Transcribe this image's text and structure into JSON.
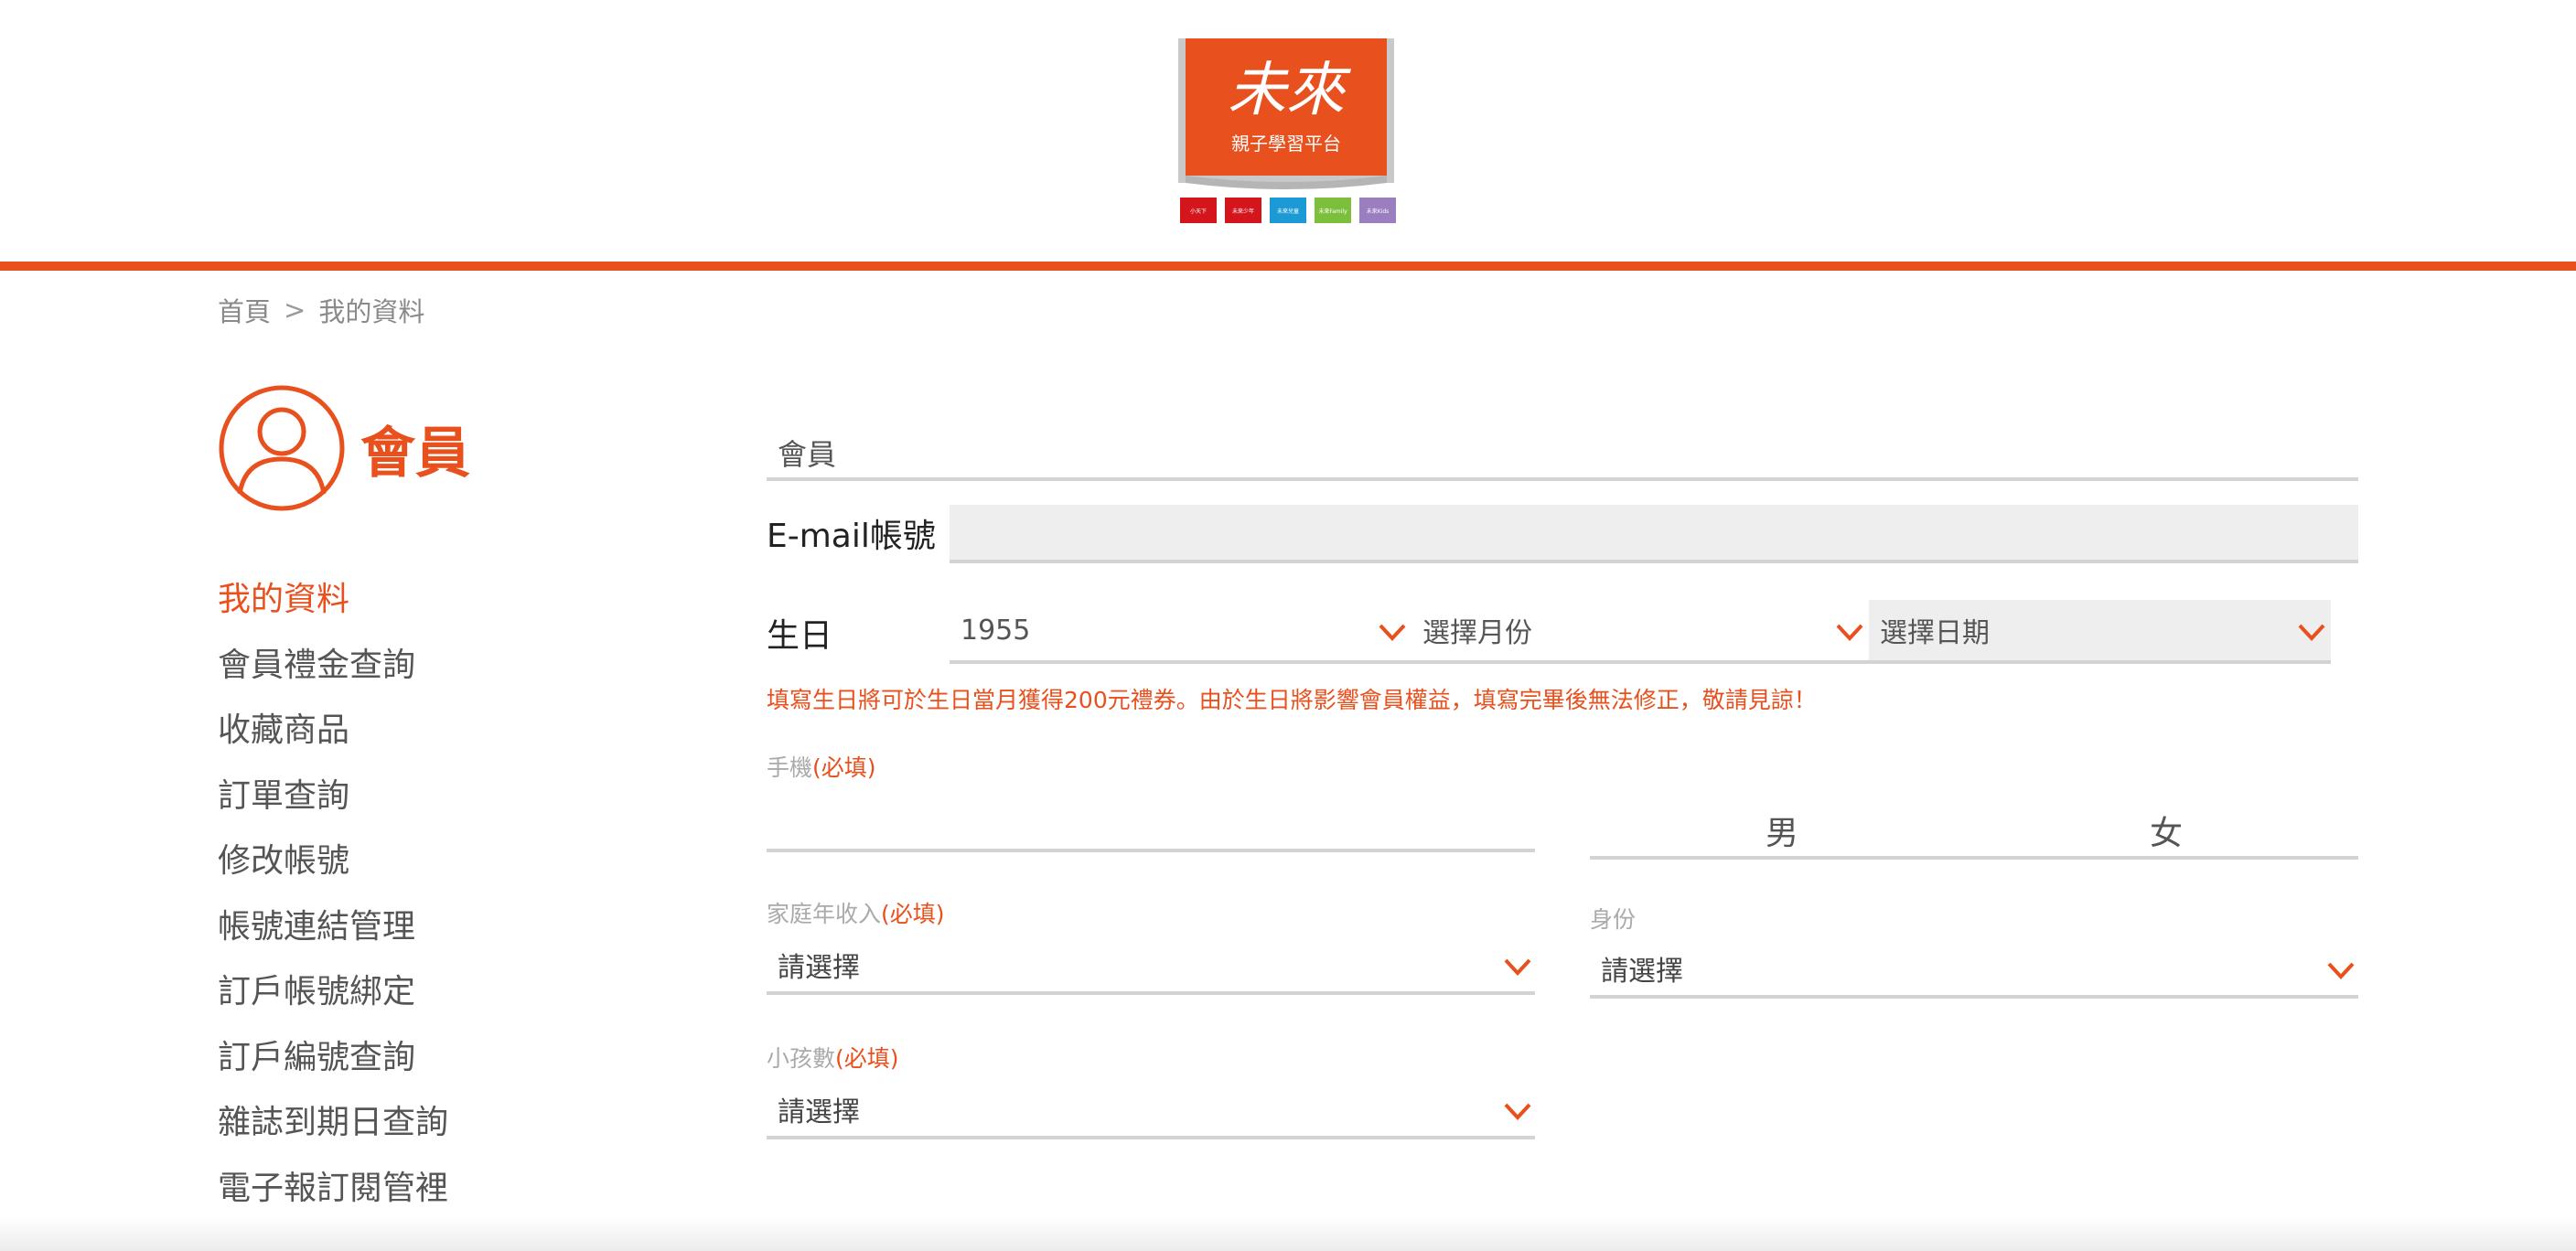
{
  "header": {
    "logo_main": "未來",
    "logo_sub": "親子學習平台",
    "logo_tabs": [
      "小天下",
      "未來少年",
      "未來兒童",
      "未來Family",
      "未來Kids"
    ],
    "accent_color": "#e8501d"
  },
  "breadcrumb": {
    "home": "首頁",
    "separator": ">",
    "current": "我的資料"
  },
  "sidebar": {
    "title": "會員",
    "avatar_icon": "user-circle-icon",
    "items": [
      {
        "label": "我的資料",
        "active": true
      },
      {
        "label": "會員禮金查詢",
        "active": false
      },
      {
        "label": "收藏商品",
        "active": false
      },
      {
        "label": "訂單查詢",
        "active": false
      },
      {
        "label": "修改帳號",
        "active": false
      },
      {
        "label": "帳號連結管理",
        "active": false
      },
      {
        "label": "訂戶帳號綁定",
        "active": false
      },
      {
        "label": "訂戶編號查詢",
        "active": false
      },
      {
        "label": "雜誌到期日查詢",
        "active": false
      },
      {
        "label": "電子報訂閱管裡",
        "active": false
      }
    ]
  },
  "form": {
    "section_title": "會員",
    "email_label": "E-mail帳號",
    "email_value": "",
    "birthday_label": "生日",
    "birth_year": "1955",
    "birth_month_placeholder": "選擇月份",
    "birth_day_placeholder": "選擇日期",
    "birthday_note": "填寫生日將可於生日當月獲得200元禮券。由於生日將影響會員權益，填寫完畢後無法修正，敬請見諒！",
    "phone_label": "手機",
    "required_mark": "(必填)",
    "phone_value": "",
    "gender_male": "男",
    "gender_female": "女",
    "income_label": "家庭年收入",
    "income_value": "請選擇",
    "identity_label": "身份",
    "identity_value": "請選擇",
    "children_label": "小孩數",
    "children_value": "請選擇"
  }
}
